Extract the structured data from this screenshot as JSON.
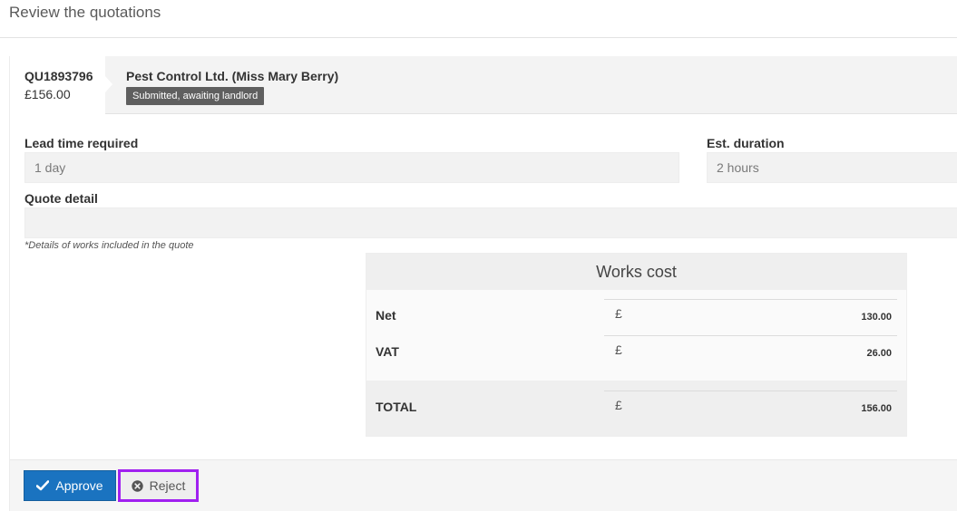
{
  "page": {
    "title": "Review the quotations"
  },
  "quote": {
    "reference": "QU1893796",
    "amount": "£156.00",
    "contractor": "Pest Control Ltd. (Miss Mary Berry)",
    "status": "Submitted, awaiting landlord"
  },
  "fields": {
    "lead_time_label": "Lead time required",
    "lead_time_value": "1 day",
    "duration_label": "Est. duration",
    "duration_value": "2 hours",
    "quote_detail_label": "Quote detail",
    "quote_detail_value": "",
    "quote_detail_hint": "*Details of works included in the quote"
  },
  "works_cost": {
    "title": "Works cost",
    "currency": "£",
    "rows": [
      {
        "label": "Net",
        "value": "130.00"
      },
      {
        "label": "VAT",
        "value": "26.00"
      }
    ],
    "total": {
      "label": "TOTAL",
      "value": "156.00"
    }
  },
  "actions": {
    "approve_label": "Approve",
    "reject_label": "Reject"
  },
  "icons": {
    "approve": "check-icon",
    "reject": "times-circle-icon"
  },
  "colors": {
    "approve_bg": "#1a73c0",
    "status_badge_bg": "#5f5f5f",
    "reject_highlight": "#a020f0"
  }
}
